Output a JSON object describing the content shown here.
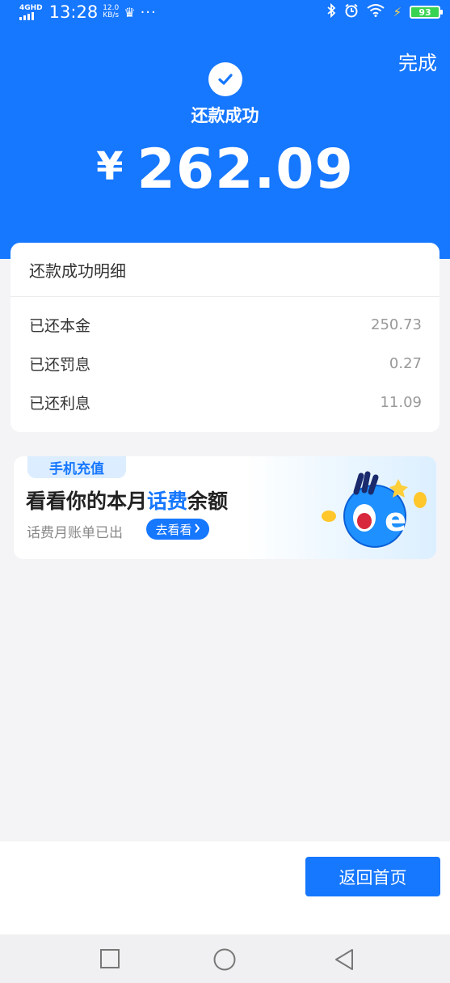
{
  "status_bar": {
    "network": "4GHD",
    "time": "13:28",
    "speed_value": "12.0",
    "speed_unit": "KB/s",
    "battery": "93",
    "icons": [
      "signal-icon",
      "crown-icon",
      "more-icon",
      "bluetooth-icon",
      "alarm-icon",
      "wifi-icon",
      "charging-icon",
      "battery-icon"
    ]
  },
  "header": {
    "done_label": "完成",
    "success_title": "还款成功",
    "currency": "¥",
    "amount": "262.09",
    "icon": "check-icon"
  },
  "detail": {
    "title": "还款成功明细",
    "rows": [
      {
        "label": "已还本金",
        "value": "250.73"
      },
      {
        "label": "已还罚息",
        "value": "0.27"
      },
      {
        "label": "已还利息",
        "value": "11.09"
      }
    ]
  },
  "promo": {
    "tag": "手机充值",
    "title_prefix": "看看你的本月",
    "title_highlight": "话费",
    "title_suffix": "余额",
    "subtitle": "话费月账单已出",
    "button_label": "去看看",
    "mascot_letter": "e"
  },
  "footer": {
    "home_button_label": "返回首页"
  },
  "colors": {
    "brand_blue": "#1677ff",
    "page_bg": "#f4f4f6",
    "value_gray": "#999999"
  }
}
